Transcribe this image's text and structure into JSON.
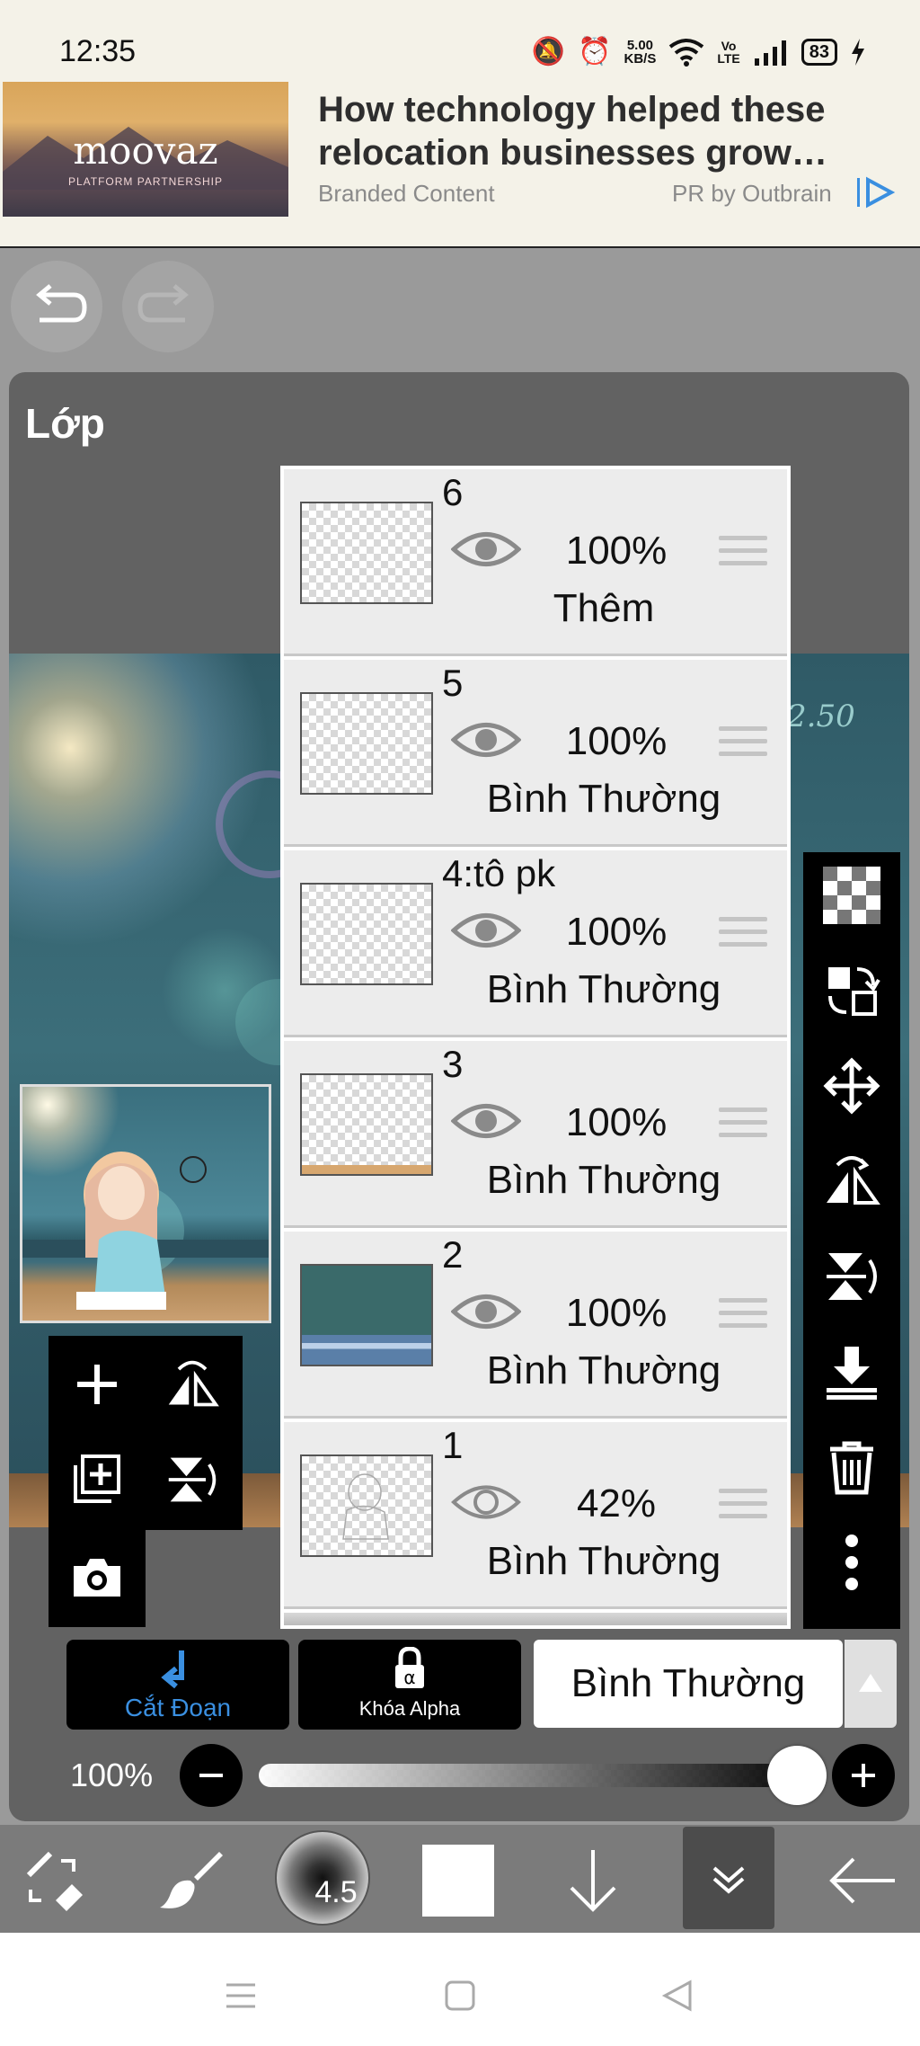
{
  "status_bar": {
    "time": "12:35",
    "net_speed_value": "5.00",
    "net_speed_unit": "KB/S",
    "volte_top": "Vo",
    "volte_bottom": "LTE",
    "battery": "83"
  },
  "ad": {
    "logo": "moovaz",
    "logo_sub": "PLATFORM PARTNERSHIP",
    "headline": "How technology helped these relocation businesses grow…",
    "branded": "Branded Content",
    "pr": "PR by Outbrain"
  },
  "panel": {
    "title": "Lớp"
  },
  "layers": [
    {
      "name": "6",
      "opacity": "100%",
      "blend": "Thêm",
      "visible": true
    },
    {
      "name": "5",
      "opacity": "100%",
      "blend": "Bình Thường",
      "visible": true
    },
    {
      "name": "4:tô pk",
      "opacity": "100%",
      "blend": "Bình Thường",
      "visible": true
    },
    {
      "name": "3",
      "opacity": "100%",
      "blend": "Bình Thường",
      "visible": true
    },
    {
      "name": "2",
      "opacity": "100%",
      "blend": "Bình Thường",
      "visible": true
    },
    {
      "name": "1",
      "opacity": "42%",
      "blend": "Bình Thường",
      "visible": false
    }
  ],
  "controls": {
    "clip_label": "Cắt Đoạn",
    "alpha_lock_label": "Khóa Alpha",
    "blend_mode": "Bình Thường",
    "opacity_label": "100%",
    "opacity_value": 1.0
  },
  "toolbar": {
    "brush_size": "4.5"
  },
  "colors": {
    "accent_blue": "#3a8fe0",
    "panel_bg": "#626262",
    "canvas_teal": "#3c6e7a"
  }
}
